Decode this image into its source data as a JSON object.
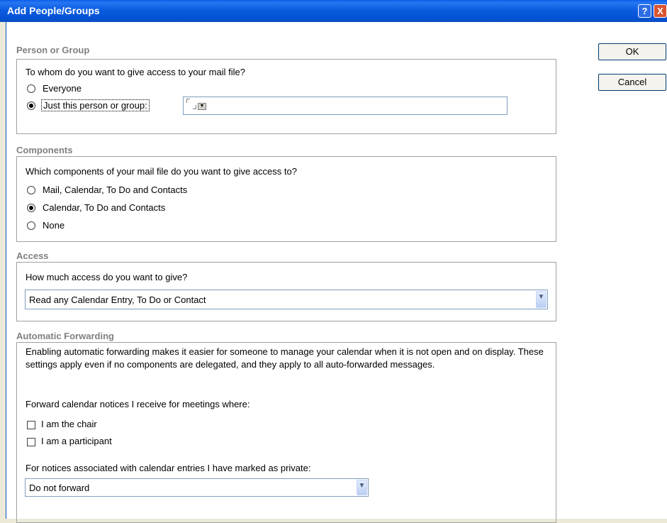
{
  "window": {
    "title": "Add People/Groups",
    "help_label": "?",
    "close_label": "X"
  },
  "buttons": {
    "ok": "OK",
    "cancel": "Cancel"
  },
  "person_group": {
    "heading": "Person or Group",
    "question": "To whom do you want to give access to your mail file?",
    "options": [
      "Everyone",
      "Just this person or group:"
    ],
    "selected": "Just this person or group:",
    "name_value": ""
  },
  "components": {
    "heading": "Components",
    "question": "Which components of your mail file do you want to give access to?",
    "options": [
      "Mail, Calendar, To Do and Contacts",
      "Calendar, To Do and Contacts",
      "None"
    ],
    "selected": "Calendar, To Do and Contacts"
  },
  "access": {
    "heading": "Access",
    "question": "How much access do you want to give?",
    "selected": "Read any Calendar Entry, To Do or Contact"
  },
  "forwarding": {
    "heading": "Automatic Forwarding",
    "description": "Enabling automatic forwarding makes it easier for someone to manage your calendar when it is not open and on display.  These settings apply even if no components are delegated, and they apply to all auto-forwarded messages.",
    "forward_label": "Forward calendar notices I receive for meetings where:",
    "checkboxes": [
      {
        "label": "I am the chair",
        "checked": false
      },
      {
        "label": "I am a participant",
        "checked": false
      }
    ],
    "private_label": "For notices associated with calendar entries I have marked as private:",
    "private_selected": "Do not forward"
  }
}
